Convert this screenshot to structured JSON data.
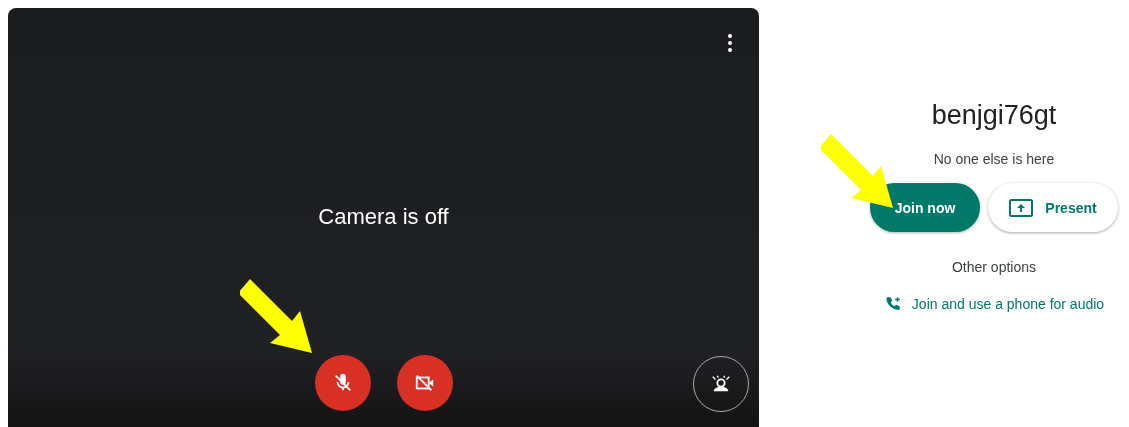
{
  "preview": {
    "message": "Camera is off",
    "mic_muted": true,
    "camera_off": true
  },
  "meeting": {
    "title": "benjgi76gt",
    "status": "No one else is here"
  },
  "buttons": [
    {
      "kind": "primary",
      "label": "Join now"
    },
    {
      "kind": "present",
      "label": "Present"
    }
  ],
  "other_options": {
    "heading": "Other options",
    "link": "Join and use a phone for audio"
  }
}
